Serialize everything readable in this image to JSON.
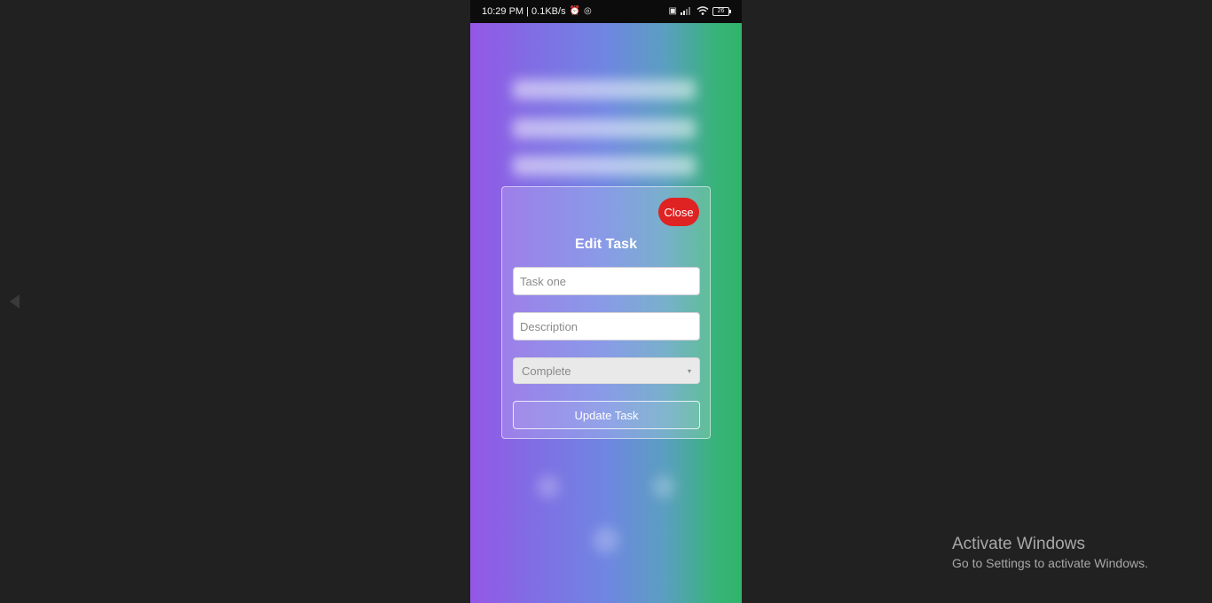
{
  "status_bar": {
    "time_speed": "10:29 PM | 0.1KB/s",
    "battery_level": "26",
    "icons": [
      "alarm-off-icon",
      "sync-icon",
      "nfc-icon",
      "signal-4g-icon",
      "wifi-icon",
      "battery-icon"
    ]
  },
  "modal": {
    "close_label": "Close",
    "title": "Edit Task",
    "task_placeholder": "Task one",
    "description_placeholder": "Description",
    "status_value": "Complete",
    "update_label": "Update Task"
  },
  "watermark": {
    "title": "Activate Windows",
    "subtitle": "Go to Settings to activate Windows."
  },
  "colors": {
    "close_button": "#df2222",
    "gradient_start": "#9457e6",
    "gradient_end": "#2fb56a",
    "desktop_bg": "#212121"
  }
}
